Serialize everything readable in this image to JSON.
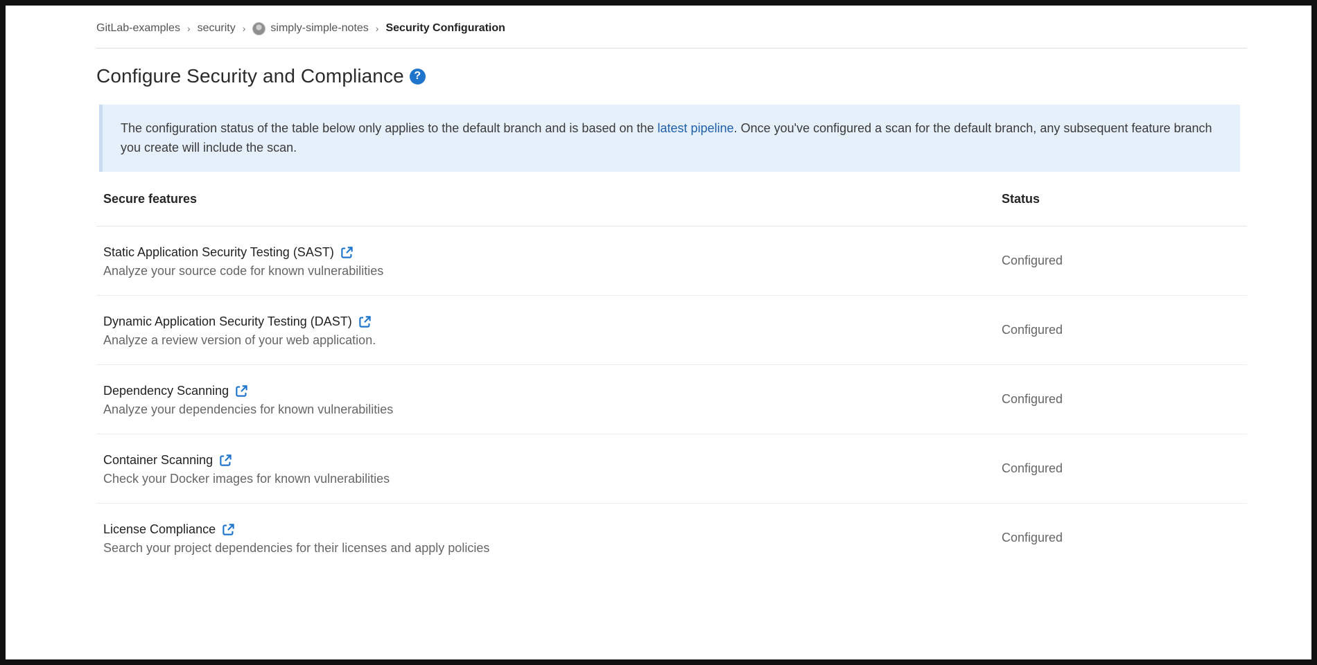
{
  "breadcrumb": {
    "items": [
      {
        "label": "GitLab-examples"
      },
      {
        "label": "security"
      },
      {
        "label": "simply-simple-notes"
      },
      {
        "label": "Security Configuration"
      }
    ]
  },
  "header": {
    "title": "Configure Security and Compliance",
    "help_icon": "question-circle-icon"
  },
  "banner": {
    "text_before": "The configuration status of the table below only applies to the default branch and is based on the ",
    "link_text": "latest pipeline",
    "text_after": ". Once you've configured a scan for the default branch, any subsequent feature branch you create will include the scan."
  },
  "table": {
    "columns": [
      "Secure features",
      "Status"
    ],
    "rows": [
      {
        "name": "Static Application Security Testing (SAST)",
        "description": "Analyze your source code for known vulnerabilities",
        "status": "Configured"
      },
      {
        "name": "Dynamic Application Security Testing (DAST)",
        "description": "Analyze a review version of your web application.",
        "status": "Configured"
      },
      {
        "name": "Dependency Scanning",
        "description": "Analyze your dependencies for known vulnerabilities",
        "status": "Configured"
      },
      {
        "name": "Container Scanning",
        "description": "Check your Docker images for known vulnerabilities",
        "status": "Configured"
      },
      {
        "name": "License Compliance",
        "description": "Search your project dependencies for their licenses and apply policies",
        "status": "Configured"
      }
    ]
  },
  "colors": {
    "accent": "#1f75cb",
    "link": "#1f5fa8",
    "banner_bg": "#e6f0fb"
  }
}
